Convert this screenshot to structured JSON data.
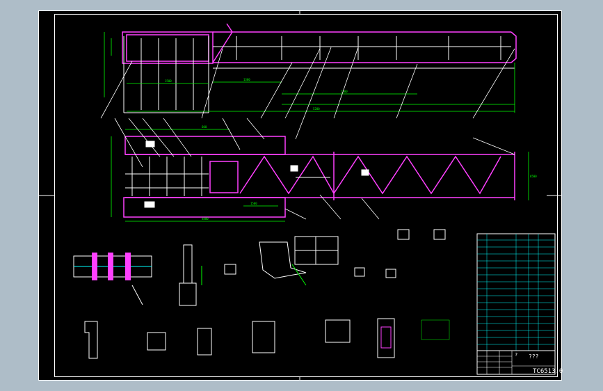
{
  "drawing": {
    "title_glyphs": "???",
    "mark_glyph": "?",
    "drawing_number": "TC6513.0"
  },
  "views": {
    "elevation_dims": [
      "1500",
      "1300",
      "2500",
      "5200"
    ],
    "plan_dims": [
      "600",
      "1500",
      "4800",
      "6500"
    ]
  },
  "colors": {
    "background": "#000000",
    "sheet_border": "#ffffff",
    "structure": "#ff40ff",
    "outline": "#ffffff",
    "dimension": "#00ff00",
    "leader": "#ffffff",
    "table": "#00ffff",
    "paper": "#aebdc8"
  }
}
